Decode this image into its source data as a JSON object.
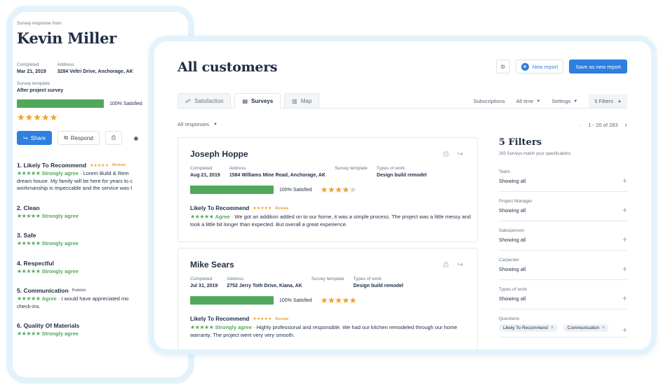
{
  "back_card": {
    "header": "Survey response from",
    "name": "Kevin Miller",
    "meta": [
      {
        "label": "Completed",
        "value": "Mar 21, 2019"
      },
      {
        "label": "Address",
        "value": "3284 Veltri Drive, Anchorage, AK"
      }
    ],
    "template_label": "Survey template",
    "template_value": "After project survey",
    "satisfaction": {
      "percent": 100,
      "text": "100% Satisfied"
    },
    "rating": 5,
    "buttons": {
      "share": "Share",
      "respond": "Respond"
    },
    "questions": [
      {
        "title": "1. Likely To Recommend",
        "tag": "Review",
        "show_mini_stars": true,
        "stars": 5,
        "verdict": "Strongly agree",
        "comment": "Lorem Build & Rem",
        "continuation": [
          "dream house. My family will be here for years to c",
          "workmanship is impeccable and the service was t"
        ]
      },
      {
        "title": "2. Clean",
        "tag": "",
        "show_mini_stars": false,
        "stars": 5,
        "verdict": "Strongly agree",
        "comment": "",
        "continuation": []
      },
      {
        "title": "3. Safe",
        "tag": "",
        "show_mini_stars": false,
        "stars": 5,
        "verdict": "Strongly agree",
        "comment": "",
        "continuation": []
      },
      {
        "title": "4. Respectful",
        "tag": "",
        "show_mini_stars": false,
        "stars": 5,
        "verdict": "Strongly agree",
        "comment": "",
        "continuation": []
      },
      {
        "title": "5. Communication",
        "tag": "Publish",
        "show_mini_stars": false,
        "stars": 4,
        "verdict": "Agree",
        "comment": "I would have appreciated mo",
        "continuation": [
          "check-ins."
        ]
      },
      {
        "title": "6. Quality Of Materials",
        "tag": "",
        "show_mini_stars": false,
        "stars": 5,
        "verdict": "Strongly agree",
        "comment": "",
        "continuation": []
      }
    ]
  },
  "main": {
    "title": "All customers",
    "actions": {
      "new_report": "New report",
      "save_as_new": "Save as new report"
    },
    "tabs": [
      {
        "label": "Satisfaction",
        "icon": "satisfaction-icon",
        "active": false
      },
      {
        "label": "Surveys",
        "icon": "clipboard-icon",
        "active": true
      },
      {
        "label": "Map",
        "icon": "map-icon",
        "active": false
      }
    ],
    "tools": {
      "subscriptions": "Subscriptions",
      "time": "All time",
      "settings": "Settings",
      "filters": "5 Filters"
    },
    "responses_select": "All responses",
    "pagination": "1 - 20 of 283",
    "cards": [
      {
        "name": "Joseph Hoppe",
        "completed_label": "Completed",
        "completed": "Aug 21, 2019",
        "address_label": "Address",
        "address": "1584 Williams Mine Road, Anchorage, AK",
        "template_label": "Survey template",
        "template": "",
        "work_label": "Types of work",
        "work": "Design build remodel",
        "satisfaction": {
          "percent": 100,
          "text": "100% Satisfied"
        },
        "rating": 4,
        "question": "Likely To Recommend",
        "question_stars": 4,
        "tag": "Review",
        "answer_stars": 4,
        "verdict": "Agree",
        "comment": "We got an addition added on to our home, it was a simple process. The project was a little messy and took a little bit longer than expected. But overall a great experience."
      },
      {
        "name": "Mike Sears",
        "completed_label": "Completed",
        "completed": "Jul 31, 2019",
        "address_label": "Address",
        "address": "2752 Jerry Toth Drive, Kiana, AK",
        "template_label": "Survey template",
        "template": "",
        "work_label": "Types of work",
        "work": "Design build remodel",
        "satisfaction": {
          "percent": 100,
          "text": "100% Satisfied"
        },
        "rating": 5,
        "question": "Likely To Recommend",
        "question_stars": 5,
        "tag": "Review",
        "answer_stars": 5,
        "verdict": "Strongly agree",
        "comment": "Highly professional and responsible. We had our kitchen remodeled through our home warranty. The project went very very smooth."
      }
    ],
    "filters": {
      "title": "5 Filters",
      "subtitle": "283 Surveys match your specifications",
      "items": [
        {
          "label": "Team",
          "value": "Showing all"
        },
        {
          "label": "Project Manager",
          "value": "Showing all"
        },
        {
          "label": "Salesperson",
          "value": "Showing all"
        },
        {
          "label": "Carpenter",
          "value": "Showing all"
        },
        {
          "label": "Types of work",
          "value": "Showing all"
        }
      ],
      "questions_label": "Questions",
      "question_chips": [
        "Likely To Recommend",
        "Communication"
      ]
    }
  },
  "colors": {
    "accent": "#2d7fe0",
    "success": "#50a85b",
    "star": "#f2a024",
    "frame": "#e4f2fb"
  }
}
